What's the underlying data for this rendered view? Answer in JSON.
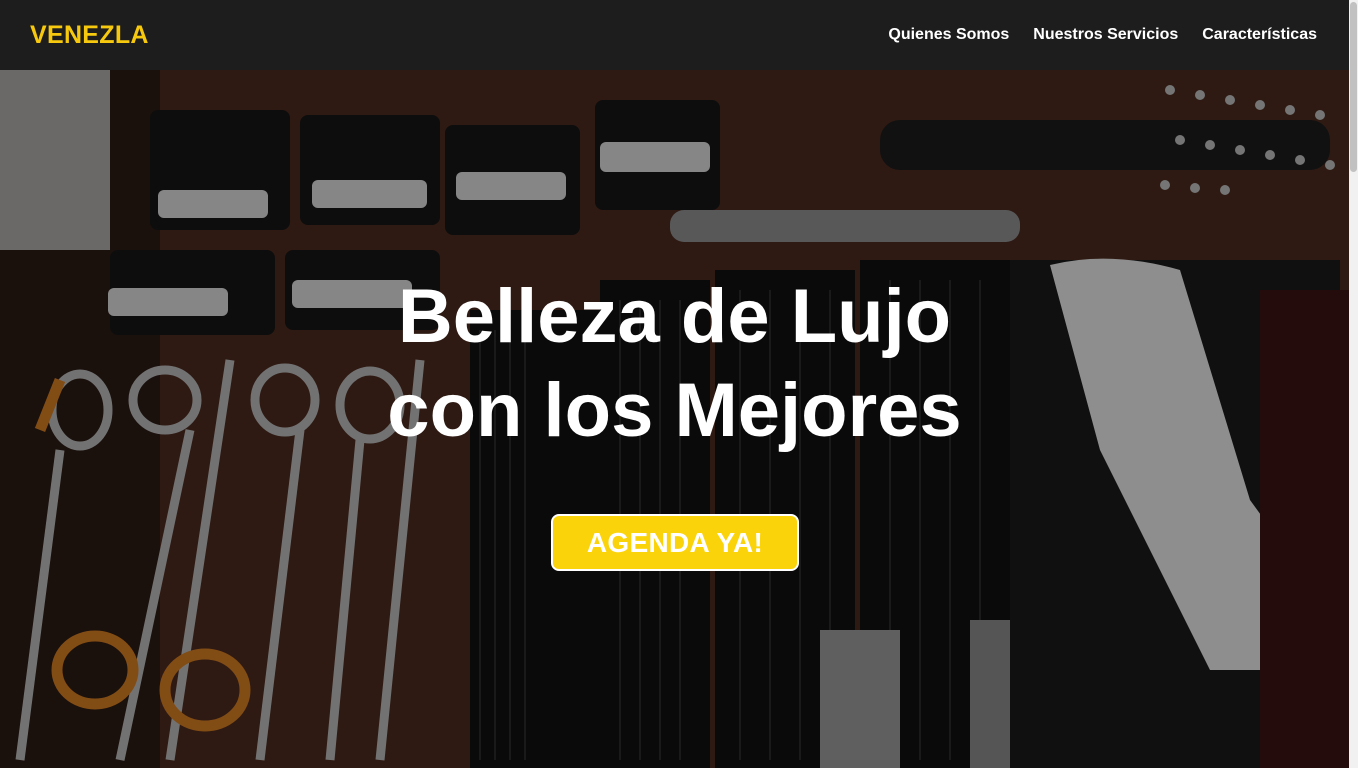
{
  "brand": {
    "name": "VENEZLA",
    "color": "#f7c90e"
  },
  "nav": {
    "items": [
      {
        "label": "Quienes Somos"
      },
      {
        "label": "Nuestros Servicios"
      },
      {
        "label": "Características"
      }
    ]
  },
  "hero": {
    "title_line1": "Belleza de Lujo",
    "title_line2": "con los Mejores",
    "cta_label": "AGENDA YA!",
    "cta_color": "#fbd30a",
    "background_image": "barber-tools-photo"
  }
}
